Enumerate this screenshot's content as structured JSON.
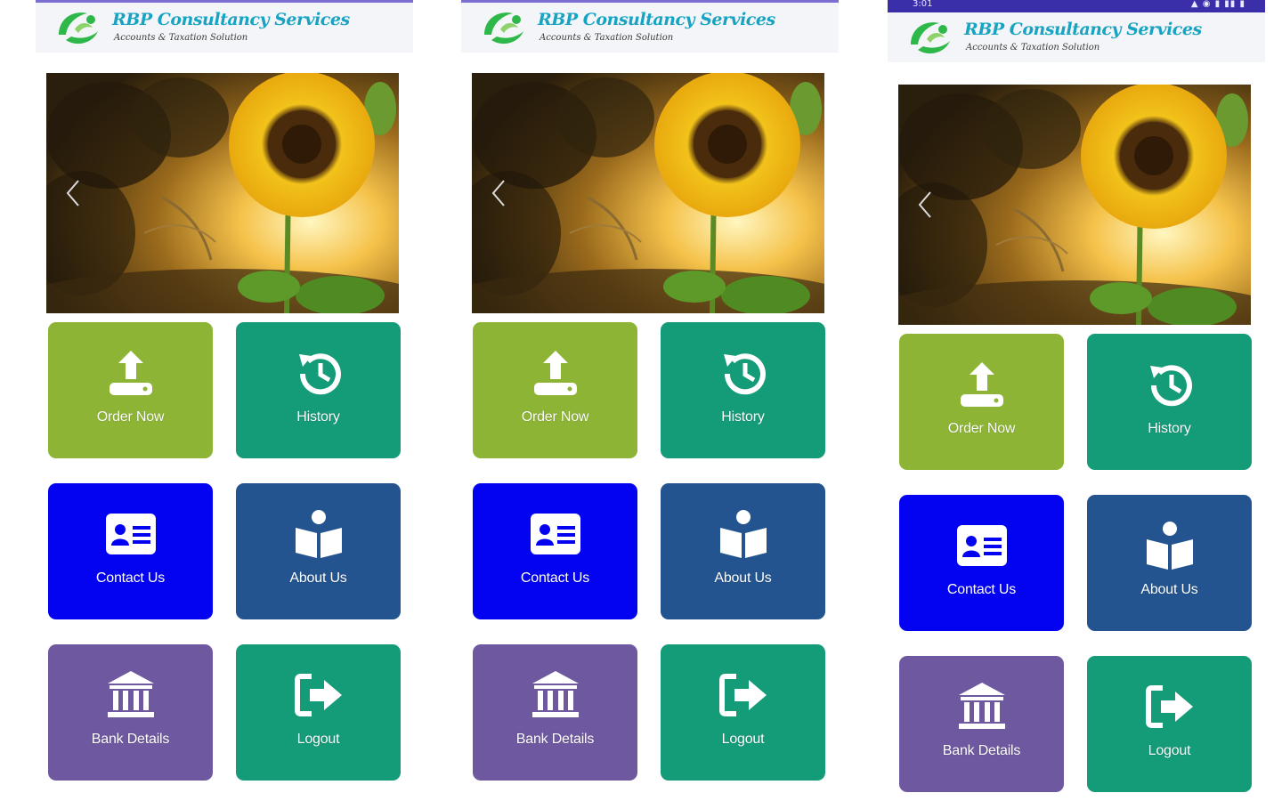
{
  "brand": {
    "name": "RBP Consultancy Services",
    "tagline": "Accounts & Taxation Solution"
  },
  "status_bar": {
    "time": "3:01",
    "icons": "▲ ◉ ▮ ▮▮ ▮"
  },
  "colors": {
    "order": "#8db434",
    "history": "#149b78",
    "contact": "#0303f2",
    "about": "#23548f",
    "bank": "#6e58a0",
    "logout": "#149b78",
    "brand_text": "#17a3c2",
    "status_bar": "#3a2fa8"
  },
  "slider": {
    "image": "sunflower-sunset",
    "prev_icon": "chevron-left-icon"
  },
  "menu": [
    {
      "id": "order",
      "label": "Order Now",
      "icon": "upload-icon"
    },
    {
      "id": "history",
      "label": "History",
      "icon": "history-icon"
    },
    {
      "id": "contact",
      "label": "Contact Us",
      "icon": "contact-card-icon"
    },
    {
      "id": "about",
      "label": "About Us",
      "icon": "reader-icon"
    },
    {
      "id": "bank",
      "label": "Bank Details",
      "icon": "bank-icon"
    },
    {
      "id": "logout",
      "label": "Logout",
      "icon": "logout-icon"
    }
  ]
}
